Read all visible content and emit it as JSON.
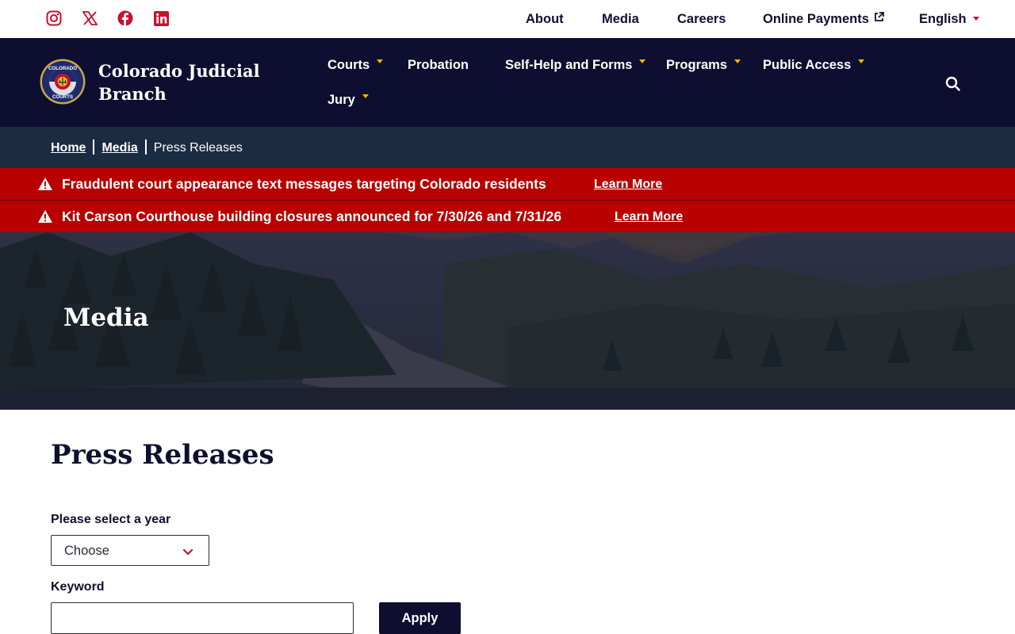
{
  "social": {
    "items": [
      {
        "name": "instagram-icon"
      },
      {
        "name": "x-twitter-icon"
      },
      {
        "name": "facebook-icon"
      },
      {
        "name": "linkedin-icon"
      }
    ],
    "color": "#c8102e"
  },
  "utility_nav": {
    "about": "About",
    "media": "Media",
    "careers": "Careers",
    "online_payments": "Online Payments",
    "language": "English"
  },
  "brand": {
    "line1": "Colorado Judicial",
    "line2": "Branch",
    "seal_text_top": "COLORADO",
    "seal_text_bottom": "COURTS"
  },
  "main_nav": {
    "courts": "Courts",
    "probation": "Probation",
    "self_help": "Self-Help and Forms",
    "programs": "Programs",
    "public_access": "Public Access",
    "jury": "Jury"
  },
  "breadcrumb": {
    "home": "Home",
    "media": "Media",
    "current": "Press Releases"
  },
  "alerts": [
    {
      "text": "Fraudulent court appearance text messages targeting Colorado residents",
      "link": "Learn More"
    },
    {
      "text": "Kit Carson Courthouse building closures announced for 7/30/26 and 7/31/26",
      "link": "Learn More"
    }
  ],
  "hero": {
    "title": "Media"
  },
  "content": {
    "heading": "Press Releases",
    "year_label": "Please select a year",
    "year_value": "Choose",
    "keyword_label": "Keyword",
    "keyword_value": "",
    "apply_label": "Apply"
  },
  "colors": {
    "navy": "#0e0e30",
    "breadcrumb_bg": "#1a2b42",
    "alert_red": "#b80000",
    "accent_gold": "#f5b400",
    "accent_red": "#c8102e"
  }
}
